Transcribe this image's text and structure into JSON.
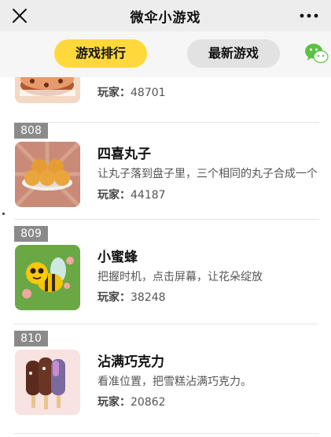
{
  "header": {
    "title": "微伞小游戏",
    "close_icon": "close-icon",
    "more_icon": "more-dots-icon"
  },
  "tabs": [
    {
      "label": "游戏排行",
      "active": true
    },
    {
      "label": "最新游戏",
      "active": false
    }
  ],
  "colors": {
    "active_tab": "#ffd93b",
    "inactive_tab": "#e2e2e2",
    "rank_badge": "#8a8a8a",
    "wechat_green": "#5ac243"
  },
  "players_label": "玩家：",
  "games": [
    {
      "rank": "",
      "name": "",
      "desc": "",
      "players": "48701",
      "icon": "cake-icon"
    },
    {
      "rank": "808",
      "name": "四喜丸子",
      "desc": "让丸子落到盘子里，三个相同的丸子合成一个",
      "players": "44187",
      "icon": "meatballs-icon"
    },
    {
      "rank": "809",
      "name": "小蜜蜂",
      "desc": "把握时机，点击屏幕，让花朵绽放",
      "players": "38248",
      "icon": "bee-icon"
    },
    {
      "rank": "810",
      "name": "沾满巧克力",
      "desc": "看准位置，把雪糕沾满巧克力。",
      "players": "20862",
      "icon": "ice-cream-icon"
    }
  ]
}
